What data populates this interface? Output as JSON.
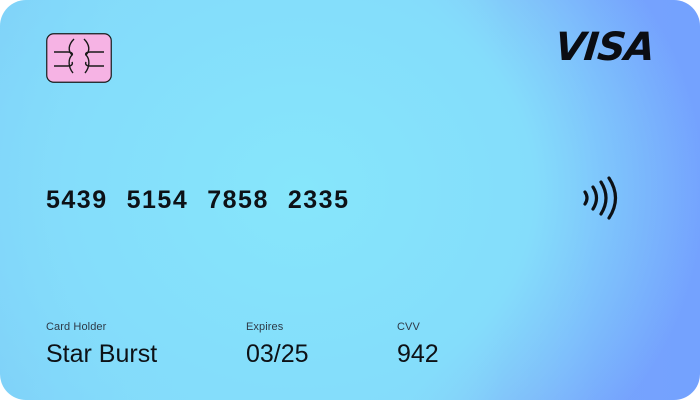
{
  "card": {
    "brand": "VISA",
    "number_groups": [
      "5439",
      "5154",
      "7858",
      "2335"
    ],
    "holder_label": "Card Holder",
    "holder_value": "Star Burst",
    "expires_label": "Expires",
    "expires_value": "03/25",
    "cvv_label": "CVV",
    "cvv_value": "942"
  },
  "icons": {
    "chip": "chip-icon",
    "contactless": "contactless-icon"
  },
  "colors": {
    "chip_fill": "#f6b3e4",
    "text": "#0d1116",
    "gradient_left": "#86e3fb",
    "gradient_right": "#74a2fe"
  }
}
